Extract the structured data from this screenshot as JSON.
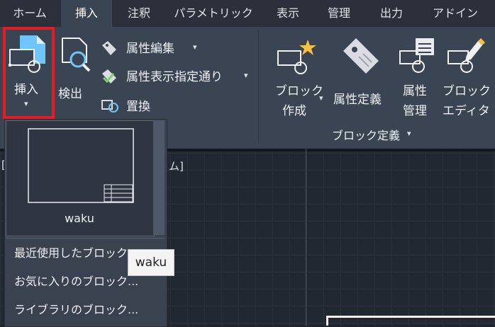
{
  "tabs": [
    {
      "label": "ホーム"
    },
    {
      "label": "挿入"
    },
    {
      "label": "注釈"
    },
    {
      "label": "パラメトリック"
    },
    {
      "label": "表示"
    },
    {
      "label": "管理"
    },
    {
      "label": "出力"
    },
    {
      "label": "アドイン"
    }
  ],
  "ribbon": {
    "insert_label": "挿入",
    "insert_caret": "▾",
    "find_label": "検出",
    "attr_edit_label": "属性編集",
    "attr_show_label": "属性表示指定通り",
    "replace_label": "置換",
    "create_block_line1": "ブロック",
    "create_block_line2": "作成",
    "attr_define_label": "属性定義",
    "attr_manage_line1": "属性",
    "attr_manage_line2": "管理",
    "block_editor_line1": "ブロック",
    "block_editor_line2": "エディタ",
    "group_block_define": "ブロック定義",
    "caret": "▾"
  },
  "canvas": {
    "viewport_label_left": "[",
    "viewport_label_right": "ム]"
  },
  "dropdown": {
    "block_name": "waku",
    "menu": [
      {
        "label": "最近使用したブロック..."
      },
      {
        "label": "お気に入りのブロック..."
      },
      {
        "label": "ライブラリのブロック..."
      }
    ]
  },
  "tooltip": {
    "text": "waku"
  },
  "colors": {
    "accent_highlight": "#e51c23",
    "ribbon_bg": "#3b4453",
    "tab_bg": "#2b303a"
  }
}
